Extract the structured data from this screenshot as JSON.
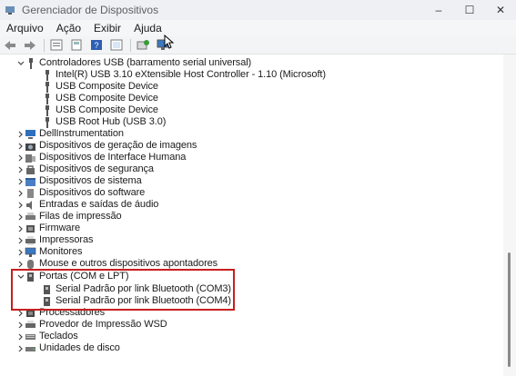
{
  "window": {
    "title": "Gerenciador de Dispositivos",
    "icon": "device-manager-icon"
  },
  "menu": [
    "Arquivo",
    "Ação",
    "Exibir",
    "Ajuda"
  ],
  "toolbar": {
    "icons": [
      "back-arrow-icon",
      "forward-arrow-icon",
      "properties-icon",
      "driver-icon",
      "help-icon",
      "update-driver-icon",
      "scan-hardware-icon",
      "monitor-icon"
    ]
  },
  "tree": {
    "usb": {
      "label": "Controladores USB (barramento serial universal)",
      "children": [
        "Intel(R) USB 3.10 eXtensible Host Controller - 1.10 (Microsoft)",
        "USB Composite Device",
        "USB Composite Device",
        "USB Composite Device",
        "USB Root Hub (USB 3.0)"
      ]
    },
    "categories_a": [
      "DellInstrumentation",
      "Dispositivos de geração de imagens",
      "Dispositivos de Interface Humana",
      "Dispositivos de segurança",
      "Dispositivos de sistema",
      "Dispositivos do software",
      "Entradas e saídas de áudio",
      "Filas de impressão",
      "Firmware",
      "Impressoras",
      "Monitores",
      "Mouse e outros dispositivos apontadores"
    ],
    "ports": {
      "label": "Portas (COM e LPT)",
      "children": [
        "Serial Padrão por link Bluetooth (COM3)",
        "Serial Padrão por link Bluetooth (COM4)"
      ]
    },
    "categories_b": [
      "Processadores",
      "Provedor de Impressão WSD",
      "Teclados",
      "Unidades de disco"
    ]
  },
  "colors": {
    "highlight": "#c81e1e",
    "window_bg": "#ffffff"
  }
}
